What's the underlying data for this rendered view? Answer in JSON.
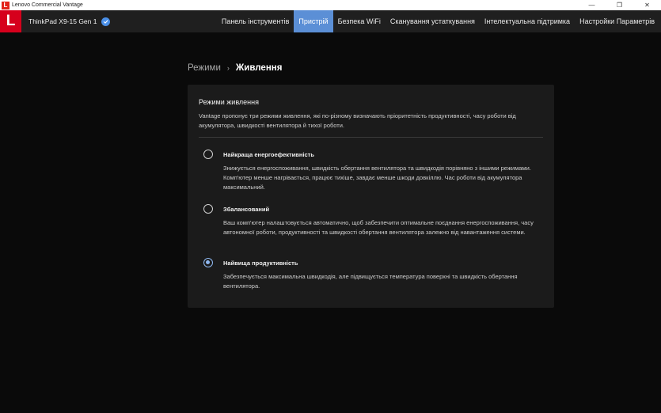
{
  "window": {
    "title": "Lenovo Commercial Vantage",
    "logo_letter": "L",
    "controls": {
      "minimize": "—",
      "restore": "❐",
      "close": "✕"
    }
  },
  "header": {
    "brand_letter": "L",
    "device_name": "ThinkPad X9-15 Gen 1",
    "verified_icon": "check-circle-icon",
    "accent": "#5b8fd6",
    "nav": [
      {
        "label": "Панель інструментів",
        "active": false
      },
      {
        "label": "Пристрій",
        "active": true
      },
      {
        "label": "Безпека WiFi",
        "active": false
      },
      {
        "label": "Сканування устаткування",
        "active": false
      },
      {
        "label": "Інтелектуальна підтримка",
        "active": false
      },
      {
        "label": "Настройки Параметрів",
        "active": false
      }
    ]
  },
  "breadcrumb": {
    "parent": "Режими",
    "separator": "›",
    "current": "Живлення"
  },
  "power": {
    "title": "Режими живлення",
    "description": "Vantage пропонує три режими живлення, які по-різному визначають пріоритетність продуктивності, часу роботи від акумулятора, швидкості вентилятора й тихої роботи.",
    "options": [
      {
        "label": "Найкраща енергоефективність",
        "description": "Знижується енергоспоживання, швидкість обертання вентилятора та швидкодія порівняно з іншими режимами. Комп'ютер менше нагрівається, працює тихіше, завдає менше шкоди довкіллю. Час роботи від акумулятора максимальний.",
        "selected": false
      },
      {
        "label": "Збалансований",
        "description": "Ваш комп'ютер налаштовується автоматично, щоб забезпечити оптимальне поєднання енергоспоживання, часу автономної роботи, продуктивності та швидкості обертання вентилятора залежно від навантаження системи.",
        "selected": false
      },
      {
        "label": "Найвища продуктивність",
        "description": "Забезпечується максимальна швидкодія, але підвищується температура поверхні та швидкість обертання вентилятора.",
        "selected": true
      }
    ]
  }
}
